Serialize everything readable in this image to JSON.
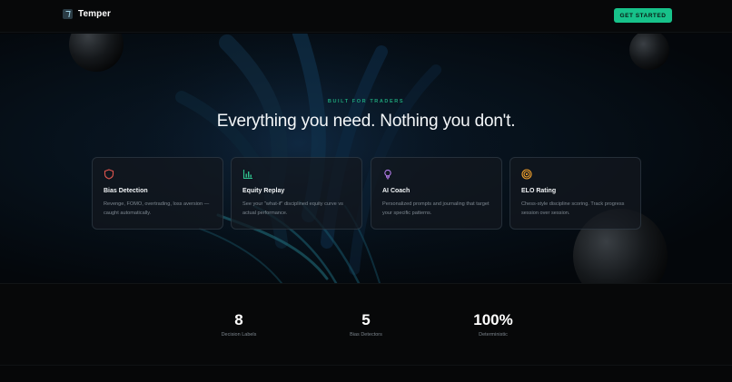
{
  "header": {
    "brand": "Temper",
    "cta_label": "GET STARTED"
  },
  "hero": {
    "eyebrow": "BUILT FOR TRADERS",
    "headline": "Everything you need. Nothing you don't."
  },
  "features": [
    {
      "icon": "shield-icon",
      "title": "Bias Detection",
      "desc": "Revenge, FOMO, overtrading, loss aversion — caught automatically.",
      "color": "#e0564f"
    },
    {
      "icon": "bar-chart-icon",
      "title": "Equity Replay",
      "desc": "See your \"what-if\" disciplined equity curve vs actual performance.",
      "color": "#2fc48f"
    },
    {
      "icon": "lightbulb-icon",
      "title": "AI Coach",
      "desc": "Personalized prompts and journaling that target your specific patterns.",
      "color": "#b07ae6"
    },
    {
      "icon": "target-icon",
      "title": "ELO Rating",
      "desc": "Chess-style discipline scoring. Track progress session over session.",
      "color": "#f2a12c"
    }
  ],
  "stats": [
    {
      "value": "8",
      "label": "Decision Labels"
    },
    {
      "value": "5",
      "label": "Bias Detectors"
    },
    {
      "value": "100%",
      "label": "Deterministic"
    }
  ],
  "colors": {
    "accent": "#17c28a",
    "background": "#050607"
  }
}
